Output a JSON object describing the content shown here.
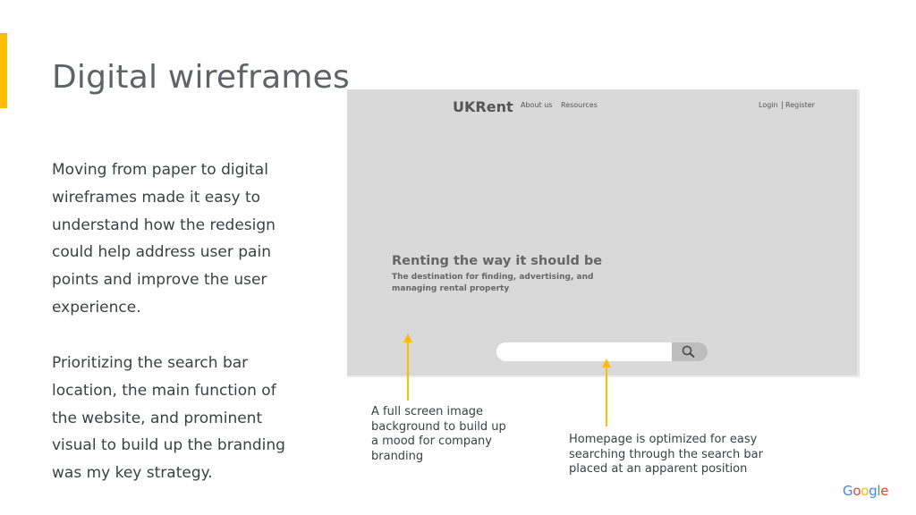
{
  "slide": {
    "title": "Digital wireframes",
    "paragraph_1": "Moving from paper to digital wireframes made it easy to understand how the redesign could help address user pain points and improve the user experience.",
    "paragraph_2": "Prioritizing the search bar location, the main function of the website, and prominent visual to build up the branding was my key strategy.",
    "accent_color": "#fbbc04"
  },
  "wireframe": {
    "logo": "UKRent",
    "nav": {
      "about": "About us",
      "resources": "Resources",
      "login": "Login",
      "register": "Register"
    },
    "headline": "Renting the way it should be",
    "subheadline": "The destination for finding, advertising, and managing rental property",
    "search_icon": "search-icon",
    "background_color": "#d9d9d9"
  },
  "annotations": {
    "left": "A full screen image background to build up a mood for company branding",
    "right": "Homepage is optimized for easy searching through the search bar placed at an apparent position",
    "arrow_color": "#fbbc04"
  },
  "footer": {
    "logo_letters": [
      "G",
      "o",
      "o",
      "g",
      "l",
      "e"
    ],
    "logo_colors": [
      "#4285f4",
      "#ea4335",
      "#fbbc04",
      "#4285f4",
      "#34a853",
      "#ea4335"
    ]
  }
}
